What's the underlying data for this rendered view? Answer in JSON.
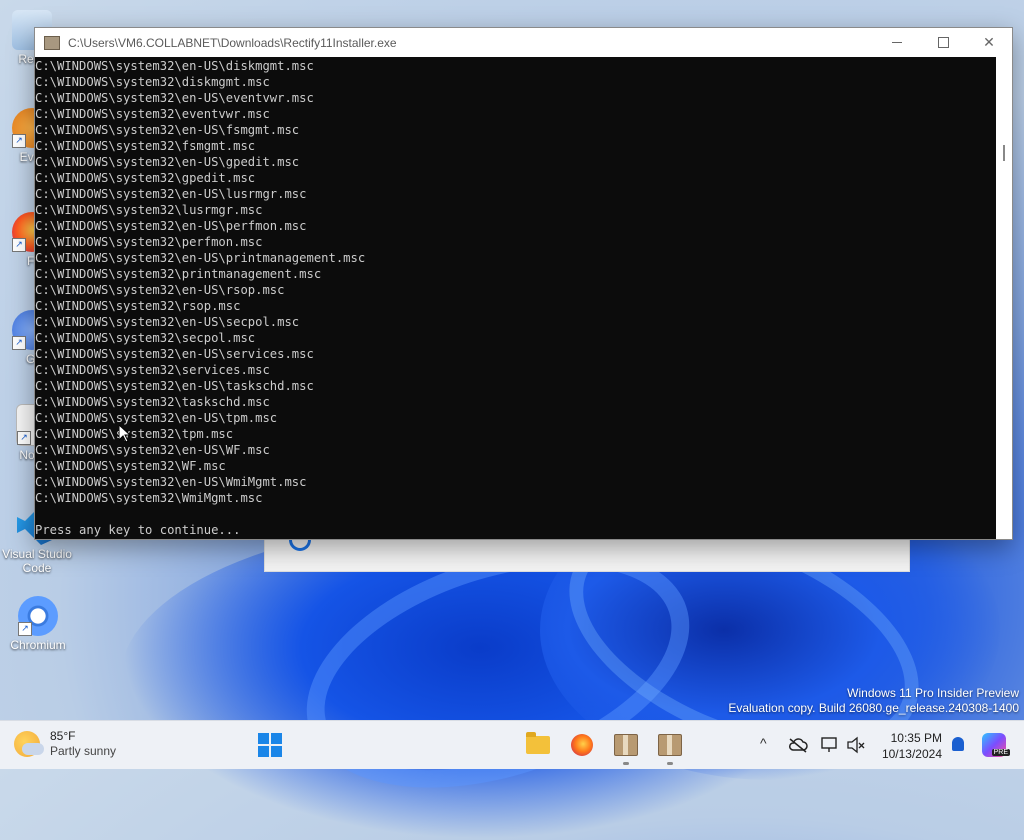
{
  "window": {
    "title": "C:\\Users\\VM6.COLLABNET\\Downloads\\Rectify11Installer.exe",
    "minimize_glyph": "—",
    "maximize_glyph": "☐",
    "close_glyph": "✕"
  },
  "console": {
    "lines": [
      "C:\\WINDOWS\\system32\\en-US\\diskmgmt.msc",
      "C:\\WINDOWS\\system32\\diskmgmt.msc",
      "C:\\WINDOWS\\system32\\en-US\\eventvwr.msc",
      "C:\\WINDOWS\\system32\\eventvwr.msc",
      "C:\\WINDOWS\\system32\\en-US\\fsmgmt.msc",
      "C:\\WINDOWS\\system32\\fsmgmt.msc",
      "C:\\WINDOWS\\system32\\en-US\\gpedit.msc",
      "C:\\WINDOWS\\system32\\gpedit.msc",
      "C:\\WINDOWS\\system32\\en-US\\lusrmgr.msc",
      "C:\\WINDOWS\\system32\\lusrmgr.msc",
      "C:\\WINDOWS\\system32\\en-US\\perfmon.msc",
      "C:\\WINDOWS\\system32\\perfmon.msc",
      "C:\\WINDOWS\\system32\\en-US\\printmanagement.msc",
      "C:\\WINDOWS\\system32\\printmanagement.msc",
      "C:\\WINDOWS\\system32\\en-US\\rsop.msc",
      "C:\\WINDOWS\\system32\\rsop.msc",
      "C:\\WINDOWS\\system32\\en-US\\secpol.msc",
      "C:\\WINDOWS\\system32\\secpol.msc",
      "C:\\WINDOWS\\system32\\en-US\\services.msc",
      "C:\\WINDOWS\\system32\\services.msc",
      "C:\\WINDOWS\\system32\\en-US\\taskschd.msc",
      "C:\\WINDOWS\\system32\\taskschd.msc",
      "C:\\WINDOWS\\system32\\en-US\\tpm.msc",
      "C:\\WINDOWS\\system32\\tpm.msc",
      "C:\\WINDOWS\\system32\\en-US\\WF.msc",
      "C:\\WINDOWS\\system32\\WF.msc",
      "C:\\WINDOWS\\system32\\en-US\\WmiMgmt.msc",
      "C:\\WINDOWS\\system32\\WmiMgmt.msc"
    ],
    "prompt": "Press any key to continue..."
  },
  "desktop_icons": [
    {
      "label": "Recy",
      "icon": "recycle-bin-icon"
    },
    {
      "label": "Ever",
      "icon": "app-icon"
    },
    {
      "label": "Fi",
      "icon": "firefox-icon"
    },
    {
      "label": "Gi",
      "icon": "github-icon"
    },
    {
      "label": "Note",
      "icon": "notepad-icon"
    },
    {
      "label": "Visual Studio Code",
      "icon": "vscode-icon"
    },
    {
      "label": "Chromium",
      "icon": "chromium-icon"
    }
  ],
  "watermark": {
    "line1": "Windows 11 Pro Insider Preview",
    "line2": "Evaluation copy. Build 26080.ge_release.240308-1400"
  },
  "taskbar": {
    "weather_temp": "85°F",
    "weather_condition": "Partly sunny",
    "clock_time": "10:35 PM",
    "clock_date": "10/13/2024",
    "tray_chevron": "^",
    "copilot_badge": "PRE"
  },
  "colors": {
    "console_bg": "#0c0c0c",
    "console_fg": "#cccccc",
    "accent": "#1a86e8"
  }
}
